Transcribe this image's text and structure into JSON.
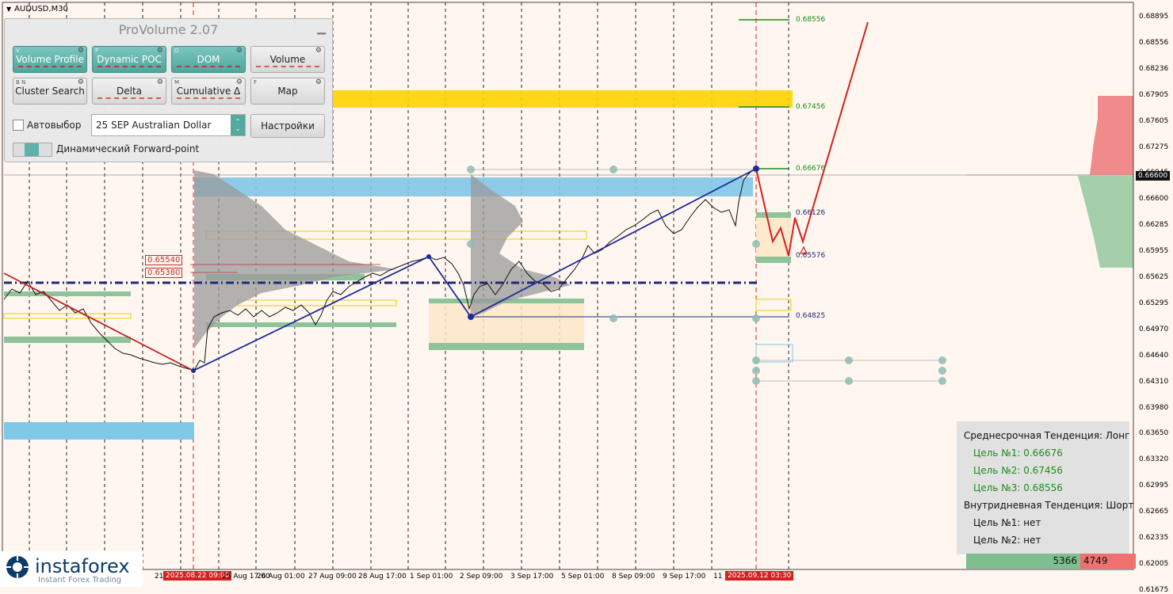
{
  "chart": {
    "symbol": "AUDUSD,M30",
    "current_price": "0.66600",
    "price_axis": [
      "0.68895",
      "0.68556",
      "0.68236",
      "0.67905",
      "0.67605",
      "0.67275",
      "0.66945",
      "0.66600",
      "0.66285",
      "0.65955",
      "0.65625",
      "0.65295",
      "0.64970",
      "0.64640",
      "0.64310",
      "0.63980",
      "0.63650",
      "0.63320",
      "0.62995",
      "0.62665",
      "0.62335",
      "0.62005",
      "0.61675"
    ],
    "time_axis": [
      "21 Aug",
      "2025.08.22 09:00",
      "25 Aug 17:00",
      "26 Aug 01:00",
      "27 Aug 09:00",
      "28 Aug 17:00",
      "1 Sep 01:00",
      "2 Sep 09:00",
      "3 Sep 17:00",
      "5 Sep 01:00",
      "8 Sep 09:00",
      "9 Sep 17:00",
      "11",
      "2025.09.12 03:30"
    ],
    "level_labels": [
      {
        "text": "0.68556",
        "color": "#1d8a1d"
      },
      {
        "text": "0.67456",
        "color": "#1d8a1d"
      },
      {
        "text": "0.66676",
        "color": "#1d8a1d"
      },
      {
        "text": "0.66126",
        "color": "#1d2a7a"
      },
      {
        "text": "0.65576",
        "color": "#1d2a7a"
      },
      {
        "text": "0.64825",
        "color": "#1d2a7a"
      }
    ],
    "red_tags": [
      "0.65540",
      "0.65380"
    ]
  },
  "provolume": {
    "title": "ProVolume 2.07",
    "buttons": [
      {
        "key": "V",
        "label": "Volume Profile",
        "on": true
      },
      {
        "key": "P",
        "label": "Dynamic POC",
        "on": true
      },
      {
        "key": "D",
        "label": "DOM",
        "on": true
      },
      {
        "key": "",
        "label": "Volume",
        "on": false
      },
      {
        "key": "B N",
        "label": "Cluster Search",
        "on": false
      },
      {
        "key": "",
        "label": "Delta",
        "on": false
      },
      {
        "key": "M",
        "label": "Cumulative Δ",
        "on": false
      },
      {
        "key": "F",
        "label": "Map",
        "on": false
      }
    ],
    "auto_select": "Автовыбор",
    "instrument": "25 SEP Australian Dollar",
    "settings": "Настройки",
    "forward_point": "Динамический Forward-point"
  },
  "trend": {
    "mid_term": "Среднесрочная Тенденция: Лонг",
    "t1": "Цель №1: 0.66676",
    "t2": "Цель №2: 0.67456",
    "t3": "Цель №3: 0.68556",
    "intraday": "Внутридневная Тенденция: Шорт",
    "i1": "Цель №1: нет",
    "i2": "Цель №2: нет",
    "buy_volume": "5366",
    "sell_volume": "4749"
  },
  "brand": {
    "name": "instaforex",
    "tagline": "Instant Forex Trading"
  }
}
